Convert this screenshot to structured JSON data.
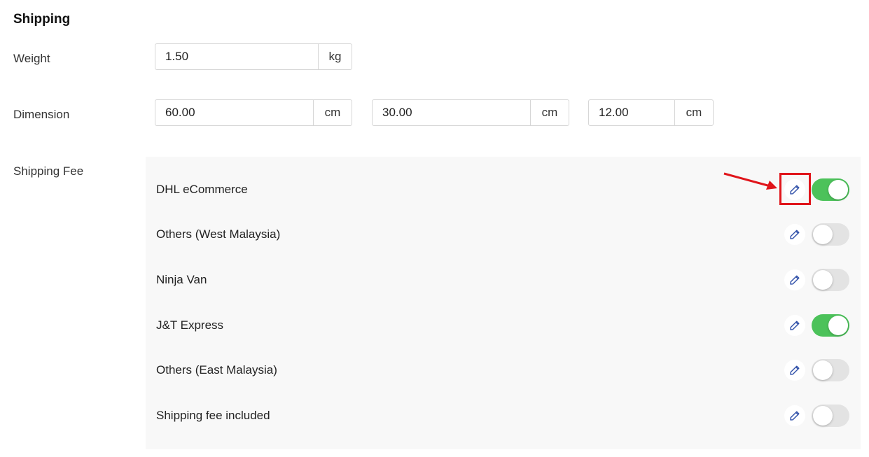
{
  "section_title": "Shipping",
  "weight": {
    "label": "Weight",
    "value": "1.50",
    "unit": "kg"
  },
  "dimension": {
    "label": "Dimension",
    "fields": [
      {
        "value": "60.00",
        "unit": "cm"
      },
      {
        "value": "30.00",
        "unit": "cm"
      },
      {
        "value": "12.00",
        "unit": "cm"
      }
    ]
  },
  "shipping_fee": {
    "label": "Shipping Fee",
    "options": [
      {
        "name": "DHL eCommerce",
        "enabled": true
      },
      {
        "name": "Others (West Malaysia)",
        "enabled": false
      },
      {
        "name": "Ninja Van",
        "enabled": false
      },
      {
        "name": "J&T Express",
        "enabled": true
      },
      {
        "name": "Others (East Malaysia)",
        "enabled": false
      },
      {
        "name": "Shipping fee included",
        "enabled": false
      }
    ]
  },
  "colors": {
    "toggle_on": "#4cc25a",
    "toggle_off": "#e3e3e3",
    "edit_icon": "#2f4fa8",
    "annotation": "#e0151b"
  },
  "icons": {
    "edit": "pencil-icon"
  }
}
